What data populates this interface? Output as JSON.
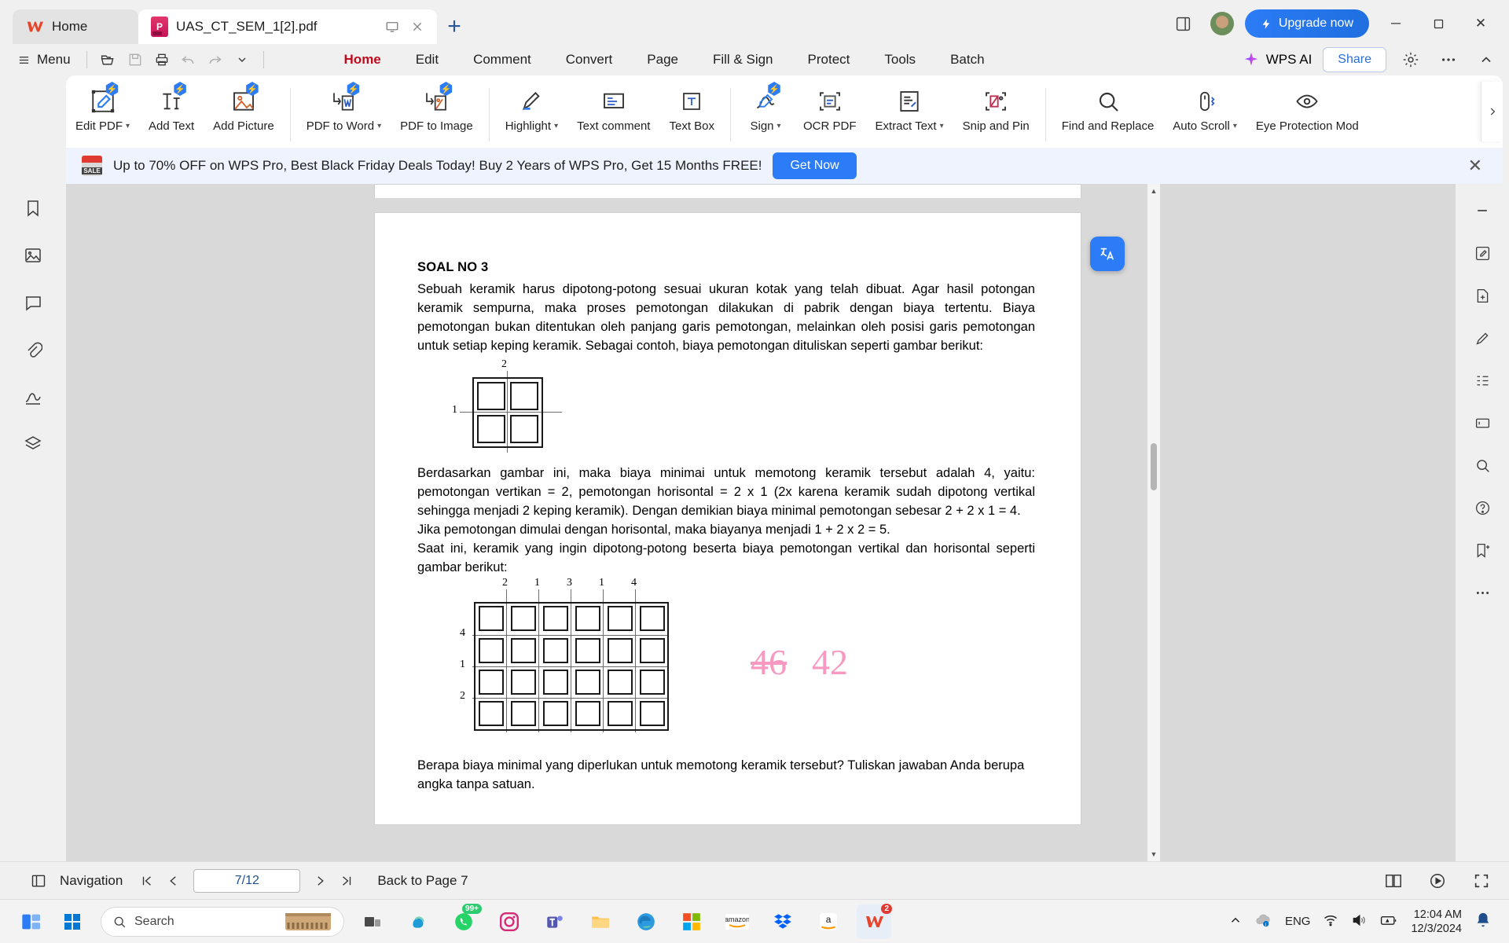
{
  "window": {
    "tabs": [
      {
        "label": "Home",
        "icon": "wps-logo",
        "active": false
      },
      {
        "label": "UAS_CT_SEM_1[2].pdf",
        "icon": "pdf-file-icon",
        "active": true
      }
    ],
    "new_tab_label": "+",
    "upgrade_label": "Upgrade now",
    "minimize": "─",
    "maximize": "❐",
    "close": "✕"
  },
  "menurow": {
    "menu_label": "Menu",
    "quick_icons": [
      "open-folder-icon",
      "save-icon",
      "print-icon",
      "undo-icon",
      "redo-icon",
      "more-chevron-icon"
    ],
    "ribbon_tabs": [
      {
        "label": "Home",
        "selected": true
      },
      {
        "label": "Edit",
        "selected": false
      },
      {
        "label": "Comment",
        "selected": false
      },
      {
        "label": "Convert",
        "selected": false
      },
      {
        "label": "Page",
        "selected": false
      },
      {
        "label": "Fill & Sign",
        "selected": false
      },
      {
        "label": "Protect",
        "selected": false
      },
      {
        "label": "Tools",
        "selected": false
      },
      {
        "label": "Batch",
        "selected": false
      }
    ],
    "wps_ai_label": "WPS AI",
    "share_label": "Share",
    "settings_icon": "gear-icon",
    "more_icon": "ellipsis-icon",
    "collapse_icon": "chevron-up-icon"
  },
  "toolbar": {
    "groups": [
      {
        "items": [
          {
            "label": "Edit PDF",
            "icon": "edit-pdf-icon",
            "caret": true,
            "ai": true
          },
          {
            "label": "Add Text",
            "icon": "add-text-icon",
            "caret": false,
            "ai": true
          },
          {
            "label": "Add Picture",
            "icon": "add-picture-icon",
            "caret": false,
            "ai": true
          }
        ]
      },
      {
        "items": [
          {
            "label": "PDF to Word",
            "icon": "pdf-to-word-icon",
            "caret": true,
            "ai": true
          },
          {
            "label": "PDF to Image",
            "icon": "pdf-to-image-icon",
            "caret": false,
            "ai": true
          }
        ]
      },
      {
        "items": [
          {
            "label": "Highlight",
            "icon": "highlight-icon",
            "caret": true,
            "ai": false
          },
          {
            "label": "Text comment",
            "icon": "text-comment-icon",
            "caret": false,
            "ai": false
          },
          {
            "label": "Text Box",
            "icon": "text-box-icon",
            "caret": false,
            "ai": false
          }
        ]
      },
      {
        "items": [
          {
            "label": "Sign",
            "icon": "sign-icon",
            "caret": true,
            "ai": true
          },
          {
            "label": "OCR PDF",
            "icon": "ocr-pdf-icon",
            "caret": false,
            "ai": false
          },
          {
            "label": "Extract Text",
            "icon": "extract-text-icon",
            "caret": true,
            "ai": false
          },
          {
            "label": "Snip and Pin",
            "icon": "snip-and-pin-icon",
            "caret": false,
            "ai": false
          }
        ]
      },
      {
        "items": [
          {
            "label": "Find and Replace",
            "icon": "search-icon",
            "caret": false,
            "ai": false
          },
          {
            "label": "Auto Scroll",
            "icon": "auto-scroll-icon",
            "caret": true,
            "ai": false
          },
          {
            "label": "Eye Protection Mod",
            "icon": "eye-icon",
            "caret": false,
            "ai": false
          }
        ]
      }
    ],
    "expand_icon": "chevron-right-icon"
  },
  "banner": {
    "icon": "sale-calendar-icon",
    "text": "Up to 70% OFF on WPS Pro, Best Black Friday Deals Today! Buy 2 Years of WPS Pro, Get 15 Months FREE!",
    "cta_label": "Get Now",
    "close_icon": "close-icon"
  },
  "left_rail": {
    "items": [
      "bookmark-icon",
      "thumbnail-icon",
      "comment-icon",
      "attachment-icon",
      "signature-icon",
      "layers-icon"
    ]
  },
  "right_rail": {
    "items": [
      "minimize-panel-icon",
      "edit-icon",
      "export-icon",
      "annotate-icon",
      "outline-icon",
      "form-icon",
      "search-icon",
      "help-icon",
      "bookmark-add-icon",
      "more-icon"
    ]
  },
  "document": {
    "heading": "SOAL NO 3",
    "paragraphs": [
      "Sebuah keramik harus dipotong-potong sesuai ukuran kotak yang telah dibuat. Agar hasil potongan keramik sempurna, maka proses pemotongan dilakukan di pabrik dengan biaya tertentu. Biaya pemotongan bukan ditentukan oleh panjang garis pemotongan, melainkan oleh posisi garis pemotongan untuk setiap keping keramik. Sebagai contoh, biaya pemotongan dituliskan seperti gambar berikut:",
      "Berdasarkan gambar ini, maka biaya minimai untuk memotong keramik tersebut adalah 4, yaitu: pemotongan vertikan = 2, pemotongan horisontal = 2 x 1 (2x karena keramik sudah dipotong vertikal sehingga menjadi 2 keping keramik). Dengan demikian biaya minimal pemotongan sebesar 2 + 2 x 1 = 4.",
      "Jika pemotongan dimulai dengan horisontal, maka biayanya menjadi 1 + 2 x 2 = 5.",
      "Saat ini, keramik yang ingin dipotong-potong beserta biaya pemotongan vertikal dan horisontal seperti gambar berikut:",
      "Berapa biaya minimal yang diperlukan untuk memotong keramik tersebut? Tuliskan jawaban Anda berupa angka tanpa satuan."
    ],
    "figure_small": {
      "rows": 2,
      "cols": 2,
      "vertical_cut_labels": [
        "2"
      ],
      "horizontal_cut_labels": [
        "1"
      ]
    },
    "figure_large": {
      "rows": 4,
      "cols": 6,
      "vertical_cut_labels": [
        "2",
        "1",
        "3",
        "1",
        "4"
      ],
      "horizontal_cut_labels": [
        "4",
        "1",
        "2"
      ]
    },
    "annotations": [
      {
        "text": "46",
        "struck": true,
        "color": "#f799c0"
      },
      {
        "text": "42",
        "struck": false,
        "color": "#f799c0"
      }
    ],
    "translate_fab_icon": "translate-icon"
  },
  "statusbar": {
    "navigation_label": "Navigation",
    "first_page_icon": "first-page-icon",
    "prev_page_icon": "prev-page-icon",
    "page_value": "7/12",
    "next_page_icon": "next-page-icon",
    "last_page_icon": "last-page-icon",
    "back_to_page": "Back to Page 7",
    "right_icons": [
      "page-layout-icon",
      "presentation-icon",
      "fullscreen-icon"
    ]
  },
  "taskbar": {
    "start_icon": "windows-start-icon",
    "search_placeholder": "Search",
    "apps": [
      {
        "name": "taskview-icon",
        "badge": null
      },
      {
        "name": "copilot-icon",
        "badge": null
      },
      {
        "name": "whatsapp-icon",
        "badge": "99+"
      },
      {
        "name": "instagram-icon",
        "badge": null
      },
      {
        "name": "teams-icon",
        "badge": null
      },
      {
        "name": "file-explorer-icon",
        "badge": null
      },
      {
        "name": "edge-icon",
        "badge": null
      },
      {
        "name": "microsoft-store-icon",
        "badge": null
      },
      {
        "name": "amazon-icon",
        "badge": null
      },
      {
        "name": "dropbox-icon",
        "badge": null
      },
      {
        "name": "amazon-shopping-icon",
        "badge": null
      },
      {
        "name": "wps-office-icon",
        "badge": "2"
      }
    ],
    "tray": {
      "chevron_icon": "chevron-up-icon",
      "cloud_icon": "onedrive-icon",
      "language": "ENG",
      "wifi_icon": "wifi-icon",
      "volume_icon": "volume-icon",
      "battery_icon": "battery-icon",
      "time": "12:04 AM",
      "date": "12/3/2024",
      "notification_icon": "bell-icon"
    }
  },
  "colors": {
    "accent_red": "#c00c1f",
    "accent_blue": "#2b7cf6",
    "banner_bg": "#eef3fd",
    "annotation_pink": "#f799c0"
  }
}
